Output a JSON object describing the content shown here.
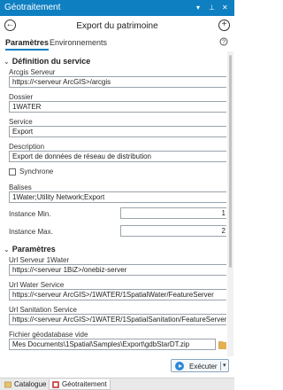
{
  "pane": {
    "title": "Géotraitement",
    "controls": {
      "dropdown": "▾",
      "pin": "⊥",
      "close": "✕"
    }
  },
  "header": {
    "tool_title": "Export du patrimoine",
    "back_icon": "←",
    "add_icon": "+"
  },
  "tabs": [
    {
      "label": "Paramètres"
    },
    {
      "label": "Environnements"
    }
  ],
  "sections": {
    "definition": {
      "title": "Définition du service",
      "arcgis_server": {
        "label": "Arcgis Serveur",
        "value": "https://<serveur ArcGIS>/arcgis"
      },
      "dossier": {
        "label": "Dossier",
        "value": "1WATER"
      },
      "service": {
        "label": "Service",
        "value": "Export"
      },
      "description": {
        "label": "Description",
        "value": "Export de données de réseau de distribution"
      },
      "synchrone": {
        "label": "Synchrone",
        "checked": false
      },
      "balises": {
        "label": "Balises",
        "value": "1Water;Utility Network;Export"
      },
      "instance_min": {
        "label": "Instance Min.",
        "value": "1"
      },
      "instance_max": {
        "label": "Instance Max.",
        "value": "2"
      }
    },
    "parametres": {
      "title": "Paramètres",
      "url_server": {
        "label": "Url Serveur 1Water",
        "value": "https://<serveur 1BiZ>/onebiz-server"
      },
      "url_water": {
        "label": "Url Water Service",
        "value": "https://<serveur ArcGIS>/1WATER/1SpatialWater/FeatureServer"
      },
      "url_sanitation": {
        "label": "Url Sanitation Service",
        "value": "https://<serveur ArcGIS>/1WATER/1SpatialSanitation/FeatureServer"
      },
      "gdb": {
        "label": "Fichier géodatabase vide",
        "value": "Mes Documents\\1Spatial\\Samples\\Export\\gdbStarDT.zip"
      }
    }
  },
  "run_button": {
    "label": "Exécuter"
  },
  "bottom_tabs": [
    {
      "label": "Catalogue"
    },
    {
      "label": "Géotraitement"
    }
  ],
  "colors": {
    "accent": "#0e7fc1",
    "run_icon": "#2b88d8",
    "folder": "#e8b04a",
    "geotraitement_icon": "#d9534f"
  }
}
